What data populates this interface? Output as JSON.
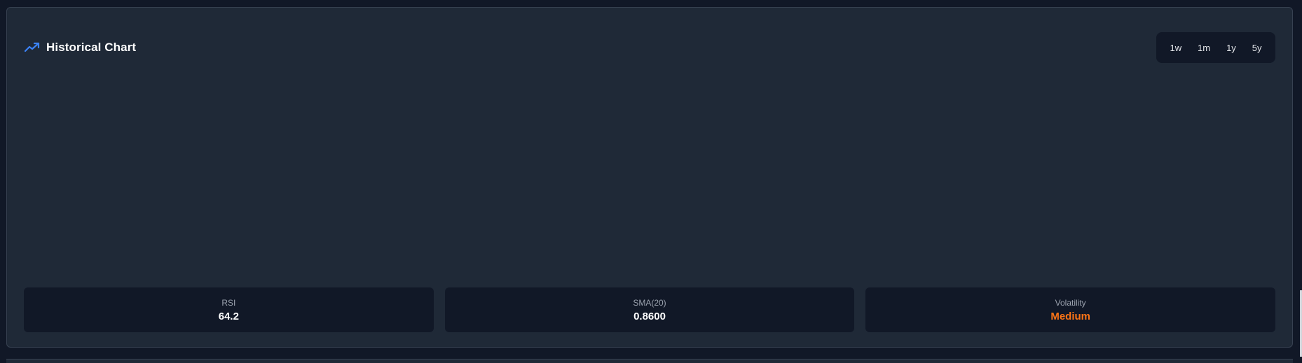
{
  "card": {
    "title": "Historical Chart",
    "title_icon": "trending-up-icon",
    "accent_color": "#3b82f6"
  },
  "ranges": [
    "1w",
    "1m",
    "1y",
    "5y"
  ],
  "stats": [
    {
      "label": "RSI",
      "value": "64.2"
    },
    {
      "label": "SMA(20)",
      "value": "0.8600"
    },
    {
      "label": "Volatility",
      "value": "Medium",
      "color": "#f97316"
    }
  ]
}
